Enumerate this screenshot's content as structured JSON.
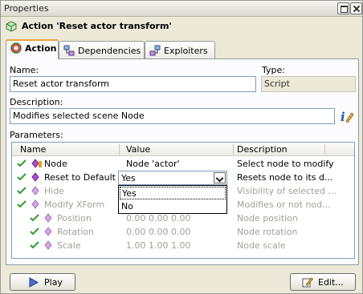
{
  "window": {
    "title": "Properties"
  },
  "header": {
    "title": "Action 'Reset actor transform'"
  },
  "tabs": [
    {
      "label": "Action",
      "active": true
    },
    {
      "label": "Dependencies",
      "active": false
    },
    {
      "label": "Exploiters",
      "active": false
    }
  ],
  "form": {
    "name_label": "Name:",
    "name_value": "Reset actor transform",
    "type_label": "Type:",
    "type_value": "Script",
    "description_label": "Description:",
    "description_value": "Modifies selected scene Node",
    "parameters_label": "Parameters:"
  },
  "grid": {
    "columns": [
      "Name",
      "Value",
      "Description"
    ],
    "rows": [
      {
        "name": "Node",
        "value": "Node 'actor'",
        "description": "Select node to modify",
        "enabled": true
      },
      {
        "name": "Reset to Default",
        "value": "Yes",
        "description": "Resets node to its d...",
        "enabled": true
      },
      {
        "name": "Hide",
        "value": "",
        "description": "Visibility of selected ...",
        "enabled": false
      },
      {
        "name": "Modify XForm",
        "value": "",
        "description": "Modifies or not nod...",
        "enabled": false
      },
      {
        "name": "Position",
        "value": "0.00  0.00  0.00",
        "description": "Node position",
        "enabled": false
      },
      {
        "name": "Rotation",
        "value": "0.00  0.00  0.00",
        "description": "Node rotation",
        "enabled": false
      },
      {
        "name": "Scale",
        "value": "1.00  1.00  1.00",
        "description": "Node scale",
        "enabled": false
      }
    ]
  },
  "combo": {
    "value": "Yes",
    "options": [
      "Yes",
      "No"
    ]
  },
  "buttons": {
    "play": "Play",
    "edit": "Edit..."
  },
  "colors": {
    "accent": "#e8a33d",
    "check": "#2e9b2e",
    "diamond": "#b04ad0"
  }
}
